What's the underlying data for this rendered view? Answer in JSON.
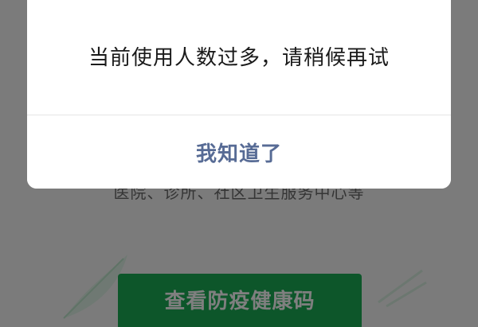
{
  "background_page": {
    "subtitle": "医院、诊所、社区卫生服务中心等",
    "health_code_button_label": "查看防疫健康码"
  },
  "dialog": {
    "message": "当前使用人数过多，请稍候再试",
    "ok_button_label": "我知道了"
  },
  "colors": {
    "mask": "#000000",
    "dialog_background": "#ffffff",
    "dialog_text": "#1a1a1a",
    "dialog_button_text": "#576b95",
    "primary_green": "#1aad55"
  }
}
